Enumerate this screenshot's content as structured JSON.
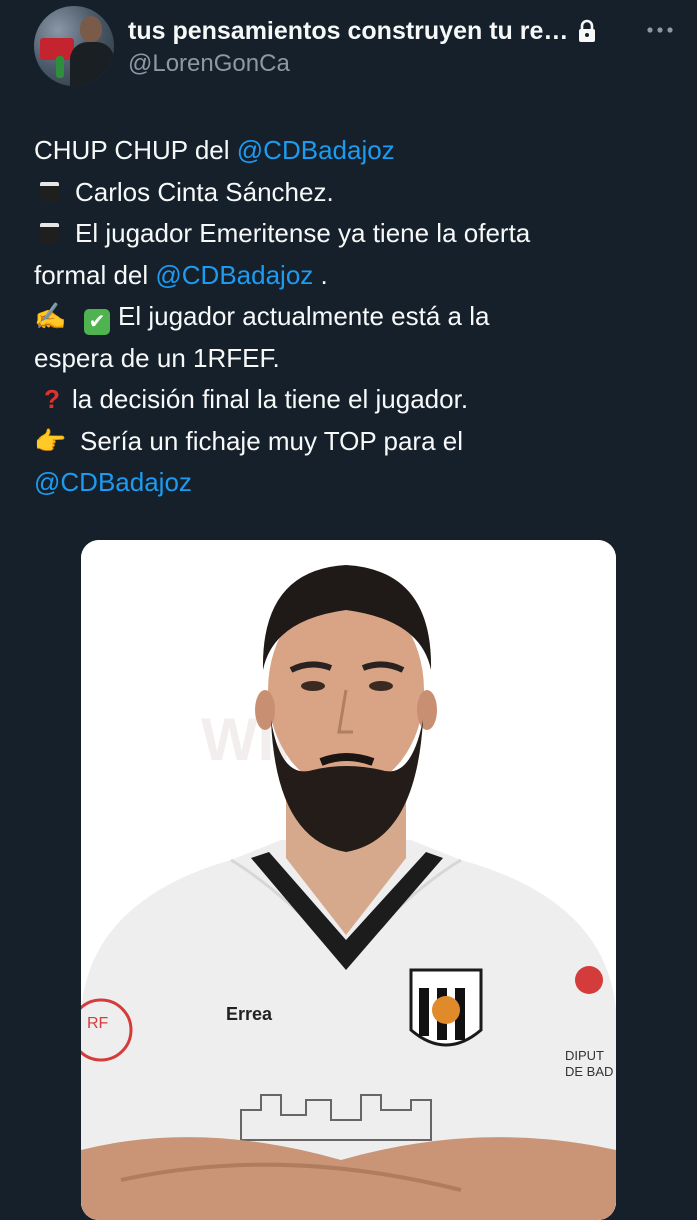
{
  "tweet": {
    "author": {
      "display_name": "tus pensamientos construyen tu re…",
      "handle": "@LorenGonCa"
    },
    "text": {
      "l1_plain": "CHUP CHUP del ",
      "l1_mention": "@CDBadajoz",
      "l2_plain": "Carlos Cinta Sánchez.",
      "l3_plain": "El jugador Emeritense ya tiene la oferta",
      "l4_plain": "formal del ",
      "l4_mention": "@CDBadajoz",
      "l4_tail": " .",
      "l5_plain": "El jugador  actualmente está  a la",
      "l6_plain": "espera de un 1RFEF.",
      "l7_plain": "la decisión final la tiene el jugador.",
      "l8_plain": "Sería un fichaje muy TOP para el",
      "l9_mention": "@CDBadajoz"
    },
    "emojis": {
      "writing_hand": "✍️",
      "check": "✔",
      "question": "?",
      "pointing": "👉"
    },
    "media": {
      "kit_text_1": "Errea",
      "kit_text_2": "RF",
      "kit_text_3": "DIPUT",
      "kit_text_4": "DE BAD"
    }
  },
  "colors": {
    "background": "#15202b",
    "text": "#f7f9f9",
    "muted": "#8b98a5",
    "link": "#1d9bf0"
  }
}
